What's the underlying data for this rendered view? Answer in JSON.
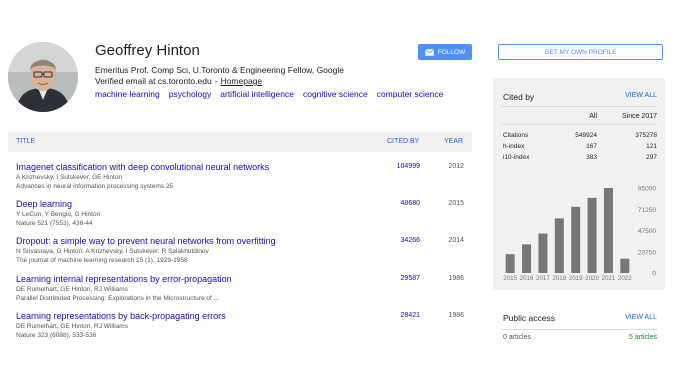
{
  "profile": {
    "name": "Geoffrey Hinton",
    "affiliation": "Emeritus Prof. Comp Sci, U.Toronto & Engineering Fellow, Google",
    "email_text": "Verified email at cs.toronto.edu",
    "separator": "-",
    "homepage_label": "Homepage",
    "interests": [
      "machine learning",
      "psychology",
      "artificial intelligence",
      "cognitive science",
      "computer science"
    ],
    "follow_label": "FOLLOW",
    "my_profile_label": "GET MY OWN PROFILE",
    "accent_color": "#4d90fe",
    "link_color": "#1a0dab"
  },
  "publications": {
    "headers": {
      "title": "TITLE",
      "cited_by": "CITED BY",
      "year": "YEAR"
    },
    "rows": [
      {
        "title": "Imagenet classification with deep convolutional neural networks",
        "authors": "A Krizhevsky, I Sutskever, GE Hinton",
        "venue": "Advances in neural information processing systems 25",
        "cited_by": "104999",
        "year": "2012"
      },
      {
        "title": "Deep learning",
        "authors": "Y LeCun, Y Bengio, G Hinton",
        "venue": "Nature 521 (7553), 436-44",
        "cited_by": "48680",
        "year": "2015"
      },
      {
        "title": "Dropout: a simple way to prevent neural networks from overfitting",
        "authors": "N Srivastava, G Hinton, A Krizhevsky, I Sutskever, R Salakhutdinov",
        "venue": "The journal of machine learning research 15 (1), 1929-1958",
        "cited_by": "34266",
        "year": "2014"
      },
      {
        "title": "Learning internal representations by error-propagation",
        "authors": "DE Rumelhart, GE Hinton, RJ Williams",
        "venue": "Parallel Distributed Processing: Explorations in the Microstructure of ...",
        "cited_by": "29587",
        "year": "1986"
      },
      {
        "title": "Learning representations by back-propagating errors",
        "authors": "DE Rumelhart, GE Hinton, RJ Williams",
        "venue": "Nature 323 (6088), 533-536",
        "cited_by": "28421",
        "year": "1986"
      }
    ]
  },
  "cited_by": {
    "label": "Cited by",
    "view_all": "VIEW ALL",
    "col_all": "All",
    "col_since": "Since 2017",
    "rows": [
      {
        "label": "Citations",
        "all": "549924",
        "since": "375278"
      },
      {
        "label": "h-index",
        "all": "167",
        "since": "121"
      },
      {
        "label": "i10-index",
        "all": "383",
        "since": "297"
      }
    ]
  },
  "chart_data": {
    "type": "bar",
    "categories": [
      "2015",
      "2016",
      "2017",
      "2018",
      "2019",
      "2020",
      "2021",
      "2022"
    ],
    "values": [
      21000,
      32000,
      44000,
      61000,
      74000,
      84000,
      95000,
      16000
    ],
    "yticks": [
      "95000",
      "71250",
      "47500",
      "23750",
      "0"
    ],
    "ylim": [
      0,
      95000
    ],
    "bar_color": "#777777",
    "title": "",
    "xlabel": "",
    "ylabel": ""
  },
  "public_access": {
    "label": "Public access",
    "view_all": "VIEW ALL",
    "not_available": "0 articles",
    "available": "5 articles"
  }
}
